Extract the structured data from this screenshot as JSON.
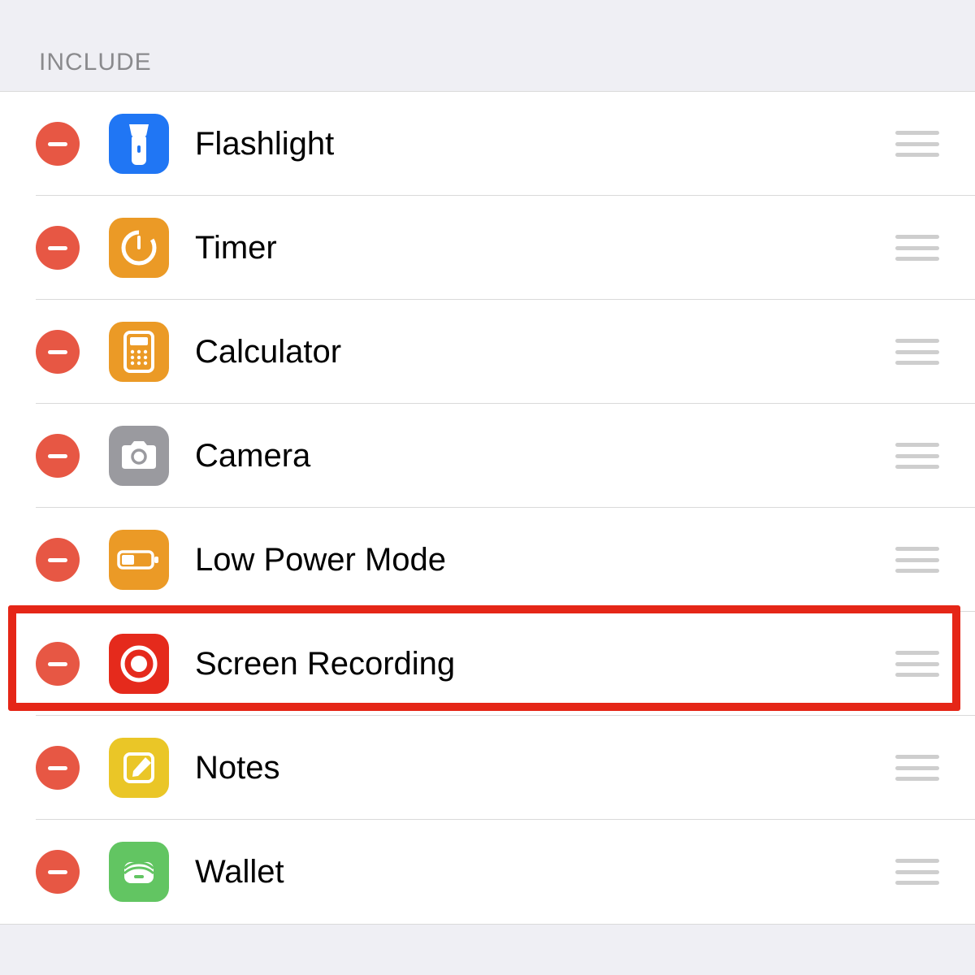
{
  "section_header": "INCLUDE",
  "rows": [
    {
      "label": "Flashlight",
      "icon": "flashlight-icon",
      "bg": "bg-blue",
      "highlighted": false
    },
    {
      "label": "Timer",
      "icon": "timer-icon",
      "bg": "bg-orange",
      "highlighted": false
    },
    {
      "label": "Calculator",
      "icon": "calculator-icon",
      "bg": "bg-orange",
      "highlighted": false
    },
    {
      "label": "Camera",
      "icon": "camera-icon",
      "bg": "bg-gray",
      "highlighted": false
    },
    {
      "label": "Low Power Mode",
      "icon": "battery-icon",
      "bg": "bg-orange",
      "highlighted": false
    },
    {
      "label": "Screen Recording",
      "icon": "record-icon",
      "bg": "bg-red",
      "highlighted": true
    },
    {
      "label": "Notes",
      "icon": "notes-icon",
      "bg": "bg-yellow",
      "highlighted": false
    },
    {
      "label": "Wallet",
      "icon": "wallet-icon",
      "bg": "bg-green",
      "highlighted": false
    }
  ]
}
